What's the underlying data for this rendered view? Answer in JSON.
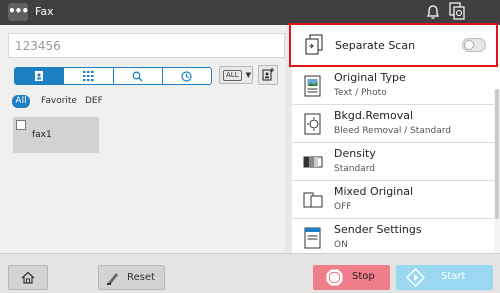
{
  "topbar": {
    "title": "Fax",
    "menu_glyph": "•••",
    "icons": [
      "menu-icon",
      "bell-icon",
      "status-icon"
    ]
  },
  "destination": {
    "value": "123456"
  },
  "addressbook": {
    "tabs": [
      "address-book-icon",
      "keypad-icon",
      "search-icon",
      "history-icon"
    ],
    "filter_label": "ALL",
    "index": {
      "all": "All",
      "favorite": "Favorite",
      "def": "DEF"
    },
    "entries": [
      {
        "name": "fax1"
      }
    ]
  },
  "settings": {
    "separate_scan": {
      "label": "Separate  Scan",
      "enabled": false
    },
    "items": [
      {
        "name": "Original Type",
        "value": "Text / Photo"
      },
      {
        "name": "Bkgd.Removal",
        "value": "Bleed Removal / Standard"
      },
      {
        "name": "Density",
        "value": "Standard"
      },
      {
        "name": "Mixed Original",
        "value": "OFF"
      },
      {
        "name": "Sender Settings",
        "value": "ON"
      }
    ]
  },
  "bottombar": {
    "reset_label": "Reset",
    "stop_label": "Stop",
    "start_label": "Start"
  },
  "colors": {
    "accent": "#1f7fc4",
    "highlight_border": "#e0151b",
    "stop": "#ef7d8a",
    "start": "#9ad8f2"
  }
}
